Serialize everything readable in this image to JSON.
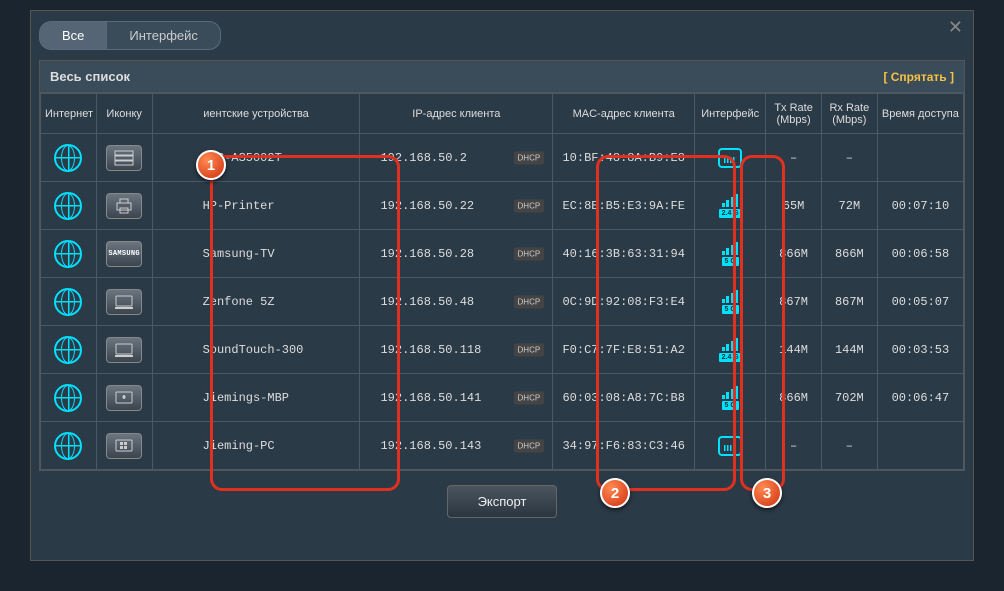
{
  "tabs": {
    "all": "Все",
    "interface": "Интерфейс"
  },
  "panel": {
    "title": "Весь список",
    "hide": "[ Спрятать ]"
  },
  "columns": {
    "internet": "Интернет",
    "icon": "Иконку",
    "device": "иентские устройства",
    "ip": "IP-адрес клиента",
    "mac": "MAC-адрес клиента",
    "iface": "Интерфейс",
    "tx": "Tx Rate (Mbps)",
    "rx": "Rx Rate (Mbps)",
    "time": "Время доступа"
  },
  "dhcp_label": "DHCP",
  "rows": [
    {
      "device": "NAS-AS5002T",
      "ip": "192.168.50.2",
      "mac": "10:BF:48:8A:B9:E8",
      "iface": "wired",
      "band": "",
      "tx": "–",
      "rx": "–",
      "time": "",
      "iconType": "nas"
    },
    {
      "device": "HP-Printer",
      "ip": "192.168.50.22",
      "mac": "EC:8E:B5:E3:9A:FE",
      "iface": "wifi",
      "band": "2.4 G",
      "tx": "65M",
      "rx": "72M",
      "time": "00:07:10",
      "iconType": "printer"
    },
    {
      "device": "Samsung-TV",
      "ip": "192.168.50.28",
      "mac": "40:16:3B:63:31:94",
      "iface": "wifi",
      "band": "5 G",
      "tx": "866M",
      "rx": "866M",
      "time": "00:06:58",
      "iconType": "samsung"
    },
    {
      "device": "Zenfone 5Z",
      "ip": "192.168.50.48",
      "mac": "0C:9D:92:08:F3:E4",
      "iface": "wifi",
      "band": "5 G",
      "tx": "867M",
      "rx": "867M",
      "time": "00:05:07",
      "iconType": "laptop"
    },
    {
      "device": "SoundTouch-300",
      "ip": "192.168.50.118",
      "mac": "F0:C7:7F:E8:51:A2",
      "iface": "wifi",
      "band": "2.4 G",
      "tx": "144M",
      "rx": "144M",
      "time": "00:03:53",
      "iconType": "laptop"
    },
    {
      "device": "Jiemings-MBP",
      "ip": "192.168.50.141",
      "mac": "60:03:08:A8:7C:B8",
      "iface": "wifi",
      "band": "5 G",
      "tx": "866M",
      "rx": "702M",
      "time": "00:06:47",
      "iconType": "mac"
    },
    {
      "device": "Jieming-PC",
      "ip": "192.168.50.143",
      "mac": "34:97:F6:83:C3:46",
      "iface": "wired",
      "band": "",
      "tx": "–",
      "rx": "–",
      "time": "",
      "iconType": "windows"
    }
  ],
  "export": "Экспорт",
  "annotations": {
    "a1": "1",
    "a2": "2",
    "a3": "3"
  }
}
